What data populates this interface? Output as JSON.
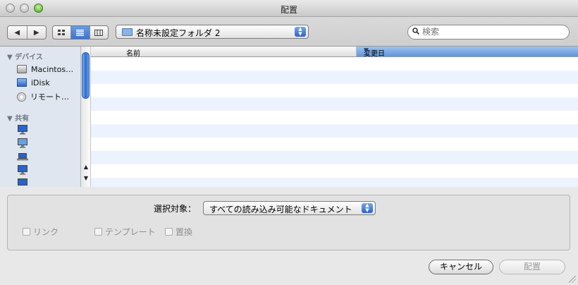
{
  "window": {
    "title": "配置"
  },
  "toolbar": {
    "back_label": "◀",
    "forward_label": "▶",
    "location": "名称未設定フォルダ 2",
    "search_placeholder": "検索"
  },
  "sidebar": {
    "devices_header": "▼ デバイス",
    "devices": [
      {
        "label": "Macintos…",
        "icon": "hard-drive-icon"
      },
      {
        "label": "iDisk",
        "icon": "idisk-icon"
      },
      {
        "label": "リモート…",
        "icon": "remote-disc-icon"
      }
    ],
    "shared_header": "▼ 共有",
    "shared_icons": [
      "computer-icon",
      "computer-icon",
      "laptop-icon",
      "computer-icon",
      "computer-icon"
    ]
  },
  "file_list": {
    "columns": [
      "名前",
      "変更日"
    ],
    "sort_indicator": "▼",
    "rows": []
  },
  "options": {
    "enable_label": "選択対象：",
    "enable_value": "すべての読み込み可能なドキュメント",
    "checkboxes": [
      "リンク",
      "テンプレート",
      "置換"
    ]
  },
  "buttons": {
    "cancel": "キャンセル",
    "place": "配置"
  },
  "colors": {
    "selection_blue": "#5f95dc",
    "stripe": "#edf3fe",
    "sidebar_bg": "#dfe6ef"
  }
}
